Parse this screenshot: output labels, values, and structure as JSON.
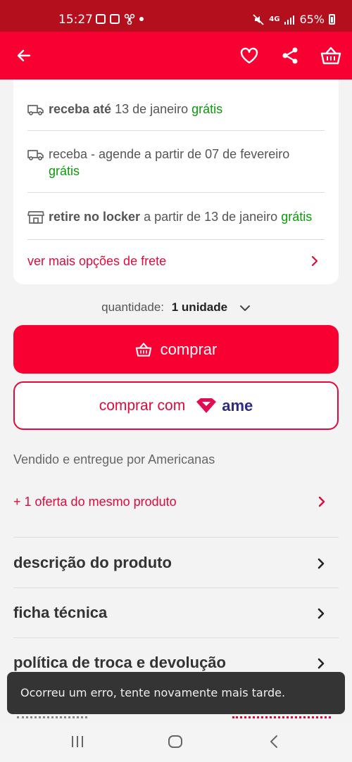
{
  "status_bar": {
    "time": "15:27",
    "network": "4G",
    "battery": "65%"
  },
  "app_bar": {
    "icons": [
      "back-arrow-icon",
      "heart-icon",
      "share-icon",
      "basket-icon"
    ]
  },
  "shipping": {
    "options": [
      {
        "icon": "truck-icon",
        "bold": "receba até",
        "text": " 13 de janeiro ",
        "price": "grátis"
      },
      {
        "icon": "truck-icon",
        "bold": "",
        "text": "receba - agende a partir de 07 de fevereiro",
        "price": "grátis"
      },
      {
        "icon": "store-icon",
        "bold": "retire no locker",
        "text": " a partir de 13 de janeiro ",
        "price": "grátis"
      }
    ],
    "more_link": "ver mais opções de frete"
  },
  "quantity": {
    "label": "quantidade:",
    "value": "1 unidade"
  },
  "buttons": {
    "buy": "comprar",
    "ame_prefix": "comprar com",
    "ame_logo": "ame"
  },
  "seller": "Vendido e entregue por Americanas",
  "offer_link": "+ 1 oferta do mesmo produto",
  "sections": [
    {
      "label": "descrição do produto"
    },
    {
      "label": "ficha técnica"
    },
    {
      "label": "política de troca e devolução"
    }
  ],
  "toast": "Ocorreu um erro, tente novamente mais tarde.",
  "colors": {
    "brand_red": "#f80032",
    "status_red": "#b30f1c",
    "link_red": "#e00a3c",
    "free_green": "#0a9b0a",
    "ame_navy": "#2d2b84"
  }
}
